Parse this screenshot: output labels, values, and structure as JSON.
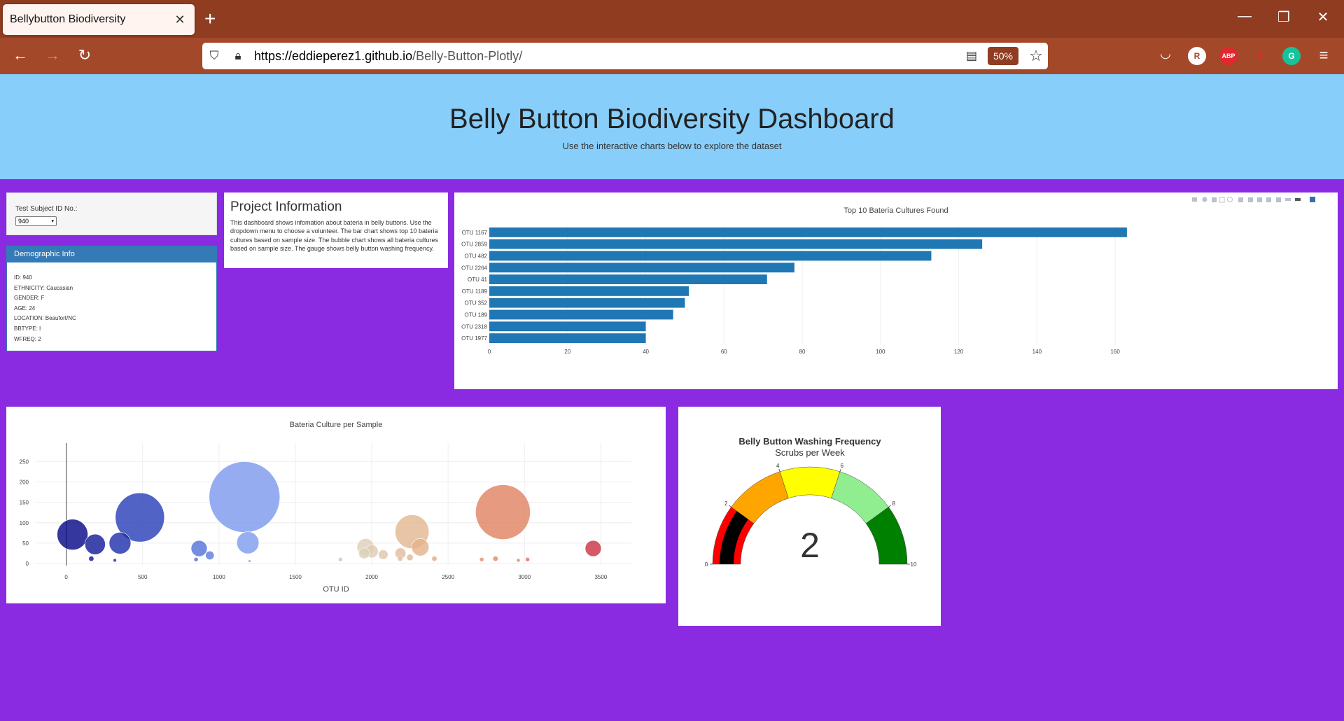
{
  "browser": {
    "tab_title": "Bellybutton Biodiversity",
    "url_host": "https://eddieperez1.github.io",
    "url_path": "/Belly-Button-Plotly/",
    "zoom": "50%",
    "ext_r": "R",
    "ext_abp": "ABP",
    "ext_t": "T",
    "ext_g": "G"
  },
  "header": {
    "title": "Belly Button Biodiversity Dashboard",
    "subtitle": "Use the interactive charts below to explore the dataset"
  },
  "selector": {
    "label": "Test Subject ID No.:",
    "value": "940"
  },
  "demographic": {
    "heading": "Demographic Info",
    "lines": [
      "ID: 940",
      "ETHNICITY: Caucasian",
      "GENDER: F",
      "AGE: 24",
      "LOCATION: Beaufort/NC",
      "BBTYPE: I",
      "WFREQ: 2"
    ]
  },
  "project": {
    "title": "Project Information",
    "text": "This dashboard shows infomation about bateria in belly buttons. Use the dropdown menu to choose a volunteer. The bar chart shows top 10 bateria cultures based on sample size. The bubble chart shows all bateria cultures based on sample size. The gauge shows belly button washing frequency."
  },
  "chart_data": [
    {
      "type": "bar",
      "orientation": "horizontal",
      "title": "Top 10 Bateria Cultures Found",
      "categories": [
        "OTU 1167",
        "OTU 2859",
        "OTU 482",
        "OTU 2264",
        "OTU 41",
        "OTU 1189",
        "OTU 352",
        "OTU 189",
        "OTU 2318",
        "OTU 1977"
      ],
      "values": [
        163,
        126,
        113,
        78,
        71,
        51,
        50,
        47,
        40,
        40
      ],
      "xlim": [
        0,
        170
      ],
      "xticks": [
        0,
        20,
        40,
        60,
        80,
        100,
        120,
        140,
        160
      ],
      "color": "#1f77b4",
      "grid": true
    },
    {
      "type": "scatter",
      "mode": "bubble",
      "title": "Bateria Culture per Sample",
      "xlabel": "OTU ID",
      "ylabel": "",
      "xlim": [
        -200,
        3700
      ],
      "ylim": [
        -5,
        295
      ],
      "xticks": [
        0,
        500,
        1000,
        1500,
        2000,
        2500,
        3000,
        3500
      ],
      "yticks": [
        0,
        50,
        100,
        150,
        200,
        250
      ],
      "colorscale": "Earth",
      "color_domain": [
        0,
        3500
      ],
      "points": [
        {
          "x": 41,
          "y": 71
        },
        {
          "x": 189,
          "y": 47
        },
        {
          "x": 352,
          "y": 50
        },
        {
          "x": 482,
          "y": 113
        },
        {
          "x": 164,
          "y": 12
        },
        {
          "x": 318,
          "y": 8
        },
        {
          "x": 870,
          "y": 37
        },
        {
          "x": 940,
          "y": 20
        },
        {
          "x": 1189,
          "y": 51
        },
        {
          "x": 1167,
          "y": 163
        },
        {
          "x": 850,
          "y": 10
        },
        {
          "x": 1200,
          "y": 6
        },
        {
          "x": 1795,
          "y": 10
        },
        {
          "x": 1960,
          "y": 40
        },
        {
          "x": 1950,
          "y": 25
        },
        {
          "x": 2000,
          "y": 30
        },
        {
          "x": 2075,
          "y": 22
        },
        {
          "x": 2188,
          "y": 25
        },
        {
          "x": 2186,
          "y": 12
        },
        {
          "x": 2264,
          "y": 78
        },
        {
          "x": 2318,
          "y": 40
        },
        {
          "x": 2250,
          "y": 15
        },
        {
          "x": 2410,
          "y": 12
        },
        {
          "x": 2859,
          "y": 126
        },
        {
          "x": 2720,
          "y": 10
        },
        {
          "x": 2810,
          "y": 12
        },
        {
          "x": 2960,
          "y": 8
        },
        {
          "x": 3020,
          "y": 10
        },
        {
          "x": 3450,
          "y": 37
        }
      ]
    },
    {
      "type": "gauge",
      "title": "Belly Button Washing Frequency",
      "subtitle": "Scrubs per Week",
      "value": 2,
      "range": [
        0,
        10
      ],
      "ticks": [
        0,
        2,
        4,
        6,
        8,
        10
      ],
      "steps": [
        {
          "range": [
            0,
            2
          ],
          "color": "#ff0000"
        },
        {
          "range": [
            2,
            4
          ],
          "color": "#ffa500"
        },
        {
          "range": [
            4,
            6
          ],
          "color": "#ffff00"
        },
        {
          "range": [
            6,
            8
          ],
          "color": "#90ee90"
        },
        {
          "range": [
            8,
            10
          ],
          "color": "#008000"
        }
      ],
      "bar_color": "#000000"
    }
  ]
}
